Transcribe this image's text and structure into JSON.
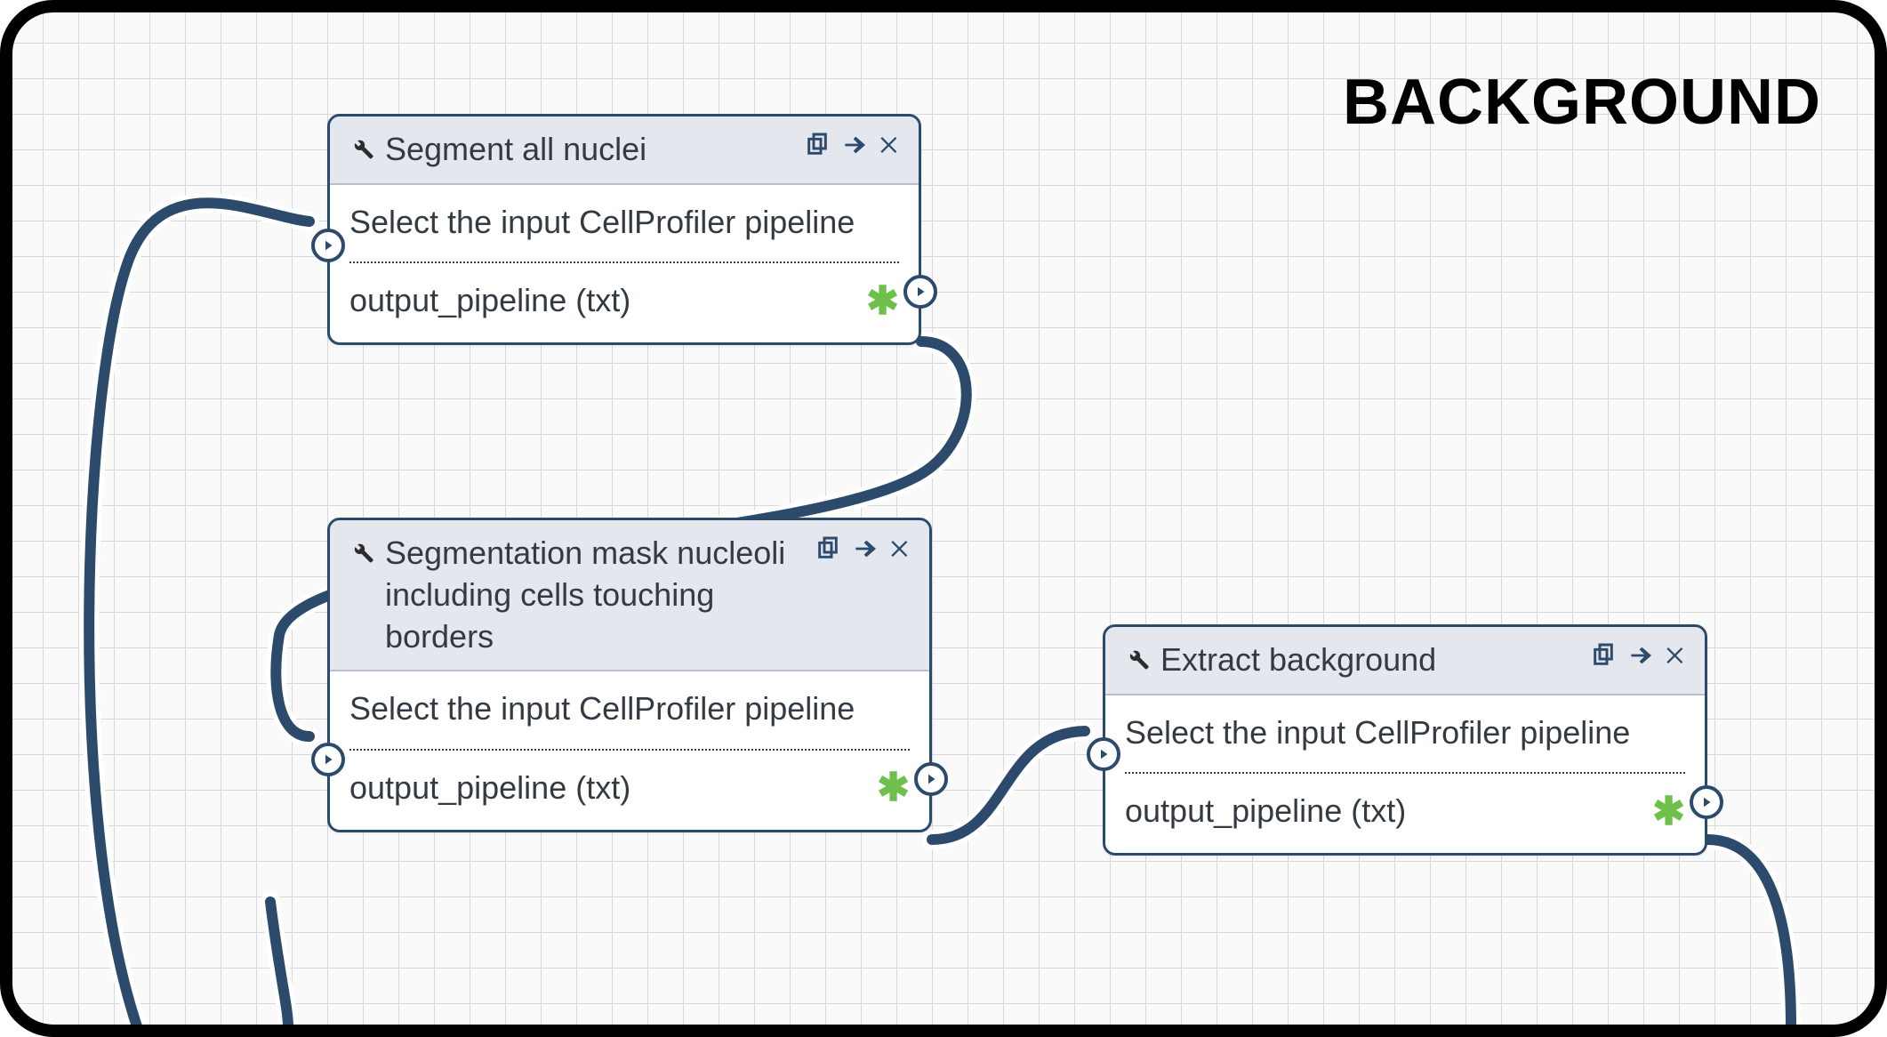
{
  "section_label": "BACKGROUND",
  "nodes": {
    "n1": {
      "title": "Segment all nuclei",
      "input_label": "Select the input CellProfiler pipeline",
      "output_label": "output_pipeline (txt)"
    },
    "n2": {
      "title": "Segmentation mask nucleoli including cells touching borders",
      "input_label": "Select the input CellProfiler pipeline",
      "output_label": "output_pipeline (txt)"
    },
    "n3": {
      "title": "Extract background",
      "input_label": "Select the input CellProfiler pipeline",
      "output_label": "output_pipeline (txt)"
    }
  },
  "colors": {
    "border": "#2c4a6b",
    "action_icon": "#2c4a6b",
    "asterisk": "#6fbf4b"
  }
}
